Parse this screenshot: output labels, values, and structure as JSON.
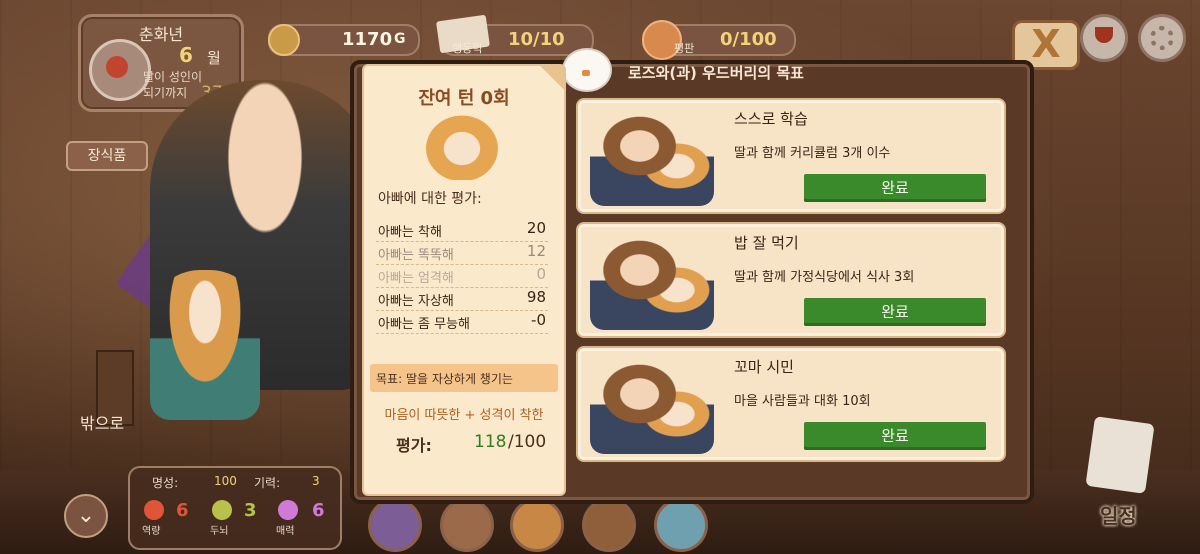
{
  "date": {
    "year_label": "춘화년",
    "month_number": "6",
    "month_unit": "월",
    "adult_line1": "딸이 성인이",
    "adult_line2": "되기까지",
    "adult_count": "37"
  },
  "currency": {
    "gold": "1170",
    "gold_unit": "G",
    "action_label": "행동력",
    "action": "10/10",
    "reputation_label": "평판",
    "reputation": "0/100"
  },
  "buttons": {
    "close": "X",
    "decor": "장식품",
    "go_out": "밖으로",
    "schedule": "일정"
  },
  "stats": {
    "fame_label": "명성:",
    "fame": "100",
    "energy_label": "기력:",
    "energy": "3",
    "strength_label": "역량",
    "strength": "6",
    "brain_label": "두뇌",
    "brain": "3",
    "charm_label": "매력",
    "charm": "6"
  },
  "board": {
    "title": "로즈와(과) 우드버리의 목표",
    "turns_left": "잔여 턴 0회",
    "eval_heading": "아빠에 대한 평가:",
    "evaluations": [
      {
        "label": "아빠는 착해",
        "value": "20",
        "dim": false
      },
      {
        "label": "아빠는 똑똑해",
        "value": "12",
        "dim": true
      },
      {
        "label": "아빠는 엄격해",
        "value": "0",
        "dim": true
      },
      {
        "label": "아빠는 자상해",
        "value": "98",
        "dim": false
      },
      {
        "label": "아빠는 좀 무능해",
        "value": "-0",
        "dim": false
      }
    ],
    "goal": "목표: 딸을 자상하게 챙기는",
    "personality": "마음이 따뜻한 + 성격이 착한",
    "score_label": "평가:",
    "score": "118",
    "score_max": "/100"
  },
  "quests": [
    {
      "title": "스스로 학습",
      "desc": "딸과 함께 커리큘럼 3개 이수",
      "button": "완료"
    },
    {
      "title": "밥 잘 먹기",
      "desc": "딸과 함께 가정식당에서 식사 3회",
      "button": "완료"
    },
    {
      "title": "꼬마 시민",
      "desc": "마을 사람들과 대화 10회",
      "button": "완료"
    }
  ],
  "colors": {
    "done_green": "#3a8a2b",
    "score_green": "#2e7d1f",
    "stat_red": "#e0553a",
    "stat_green": "#b6c24a",
    "stat_purple": "#d07ad8"
  },
  "icons": [
    "gold-coin-icon",
    "trophy-icon",
    "gear-icon",
    "close-icon",
    "chevron-down-icon",
    "quill-icon",
    "bird-mascot-icon"
  ]
}
